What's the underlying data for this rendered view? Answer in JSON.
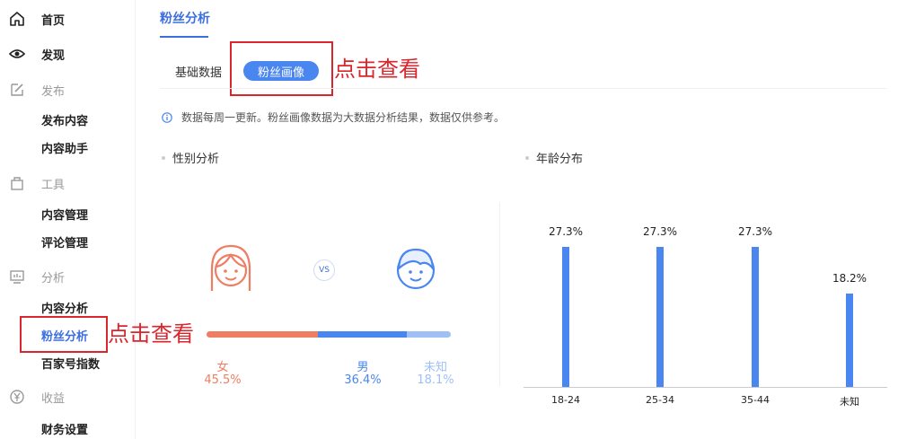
{
  "sidebar": {
    "home": "首页",
    "discover": "发现",
    "publish_group": "发布",
    "publish_content": "发布内容",
    "content_assistant": "内容助手",
    "tools_group": "工具",
    "content_manage": "内容管理",
    "comment_manage": "评论管理",
    "analysis_group": "分析",
    "content_analysis": "内容分析",
    "fans_analysis": "粉丝分析",
    "baijiahao_index": "百家号指数",
    "income_group": "收益",
    "finance_settings": "财务设置"
  },
  "annotation": {
    "note": "点击查看",
    "color": "#d9252b"
  },
  "main": {
    "tab": "粉丝分析",
    "subtabs": {
      "basic": "基础数据",
      "portrait": "粉丝画像"
    },
    "notice": "数据每周一更新。粉丝画像数据为大数据分析结果，数据仅供参考。",
    "gender": {
      "title": "性别分析",
      "vs": "VS",
      "female": {
        "label": "女",
        "value": "45.5%",
        "share": 45.5,
        "color": "#ef7d62"
      },
      "male": {
        "label": "男",
        "value": "36.4%",
        "share": 36.4,
        "color": "#4a86f0"
      },
      "unknown": {
        "label": "未知",
        "value": "18.1%",
        "share": 18.1,
        "color": "#9ec0f7"
      }
    },
    "age_title": "年龄分布"
  },
  "colors": {
    "accent": "#3b6fe0",
    "bar": "#4a86f0"
  },
  "chart_data": {
    "type": "bar",
    "title": "年龄分布",
    "categories": [
      "18-24",
      "25-34",
      "35-44",
      "未知"
    ],
    "values": [
      27.3,
      27.3,
      27.3,
      18.2
    ],
    "value_labels": [
      "27.3%",
      "27.3%",
      "27.3%",
      "18.2%"
    ],
    "ylim": [
      0,
      30
    ],
    "grid": false
  }
}
